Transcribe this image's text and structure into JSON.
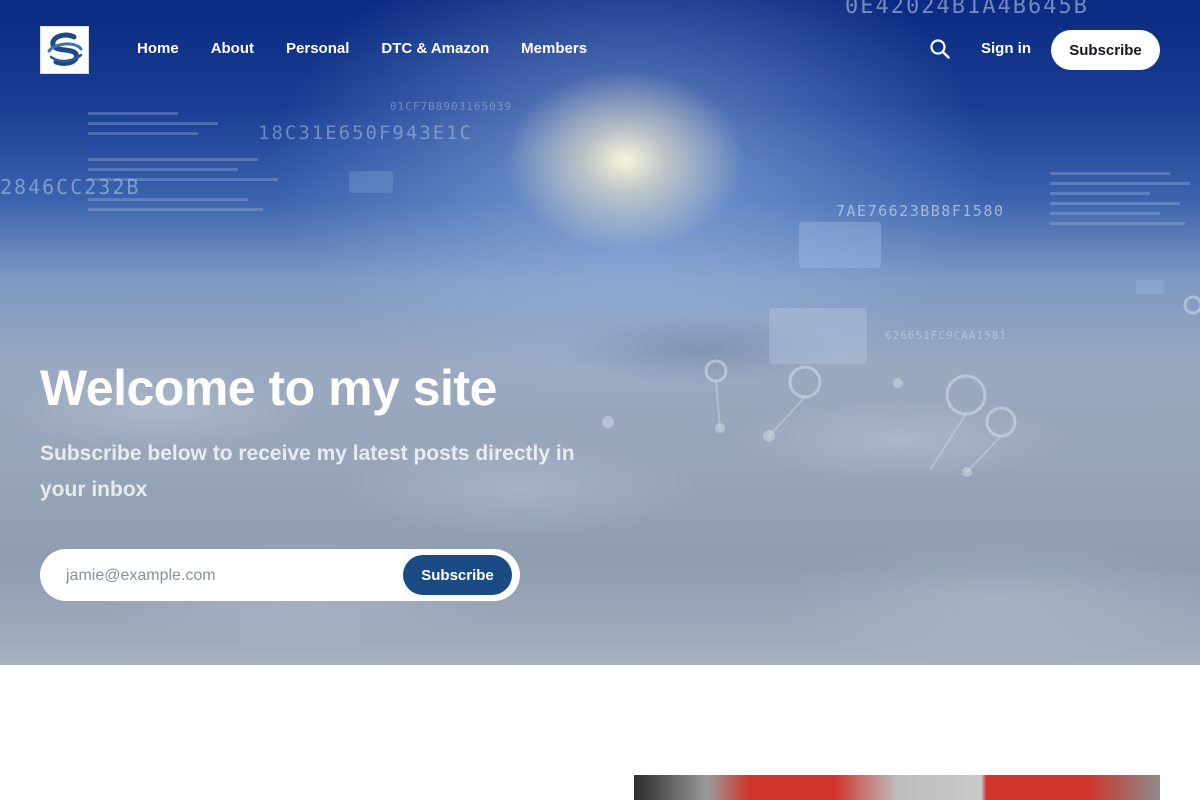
{
  "site": {
    "logo_alt": "Site logo",
    "brand_color": "#1b4b84"
  },
  "nav": {
    "items": [
      {
        "label": "Home"
      },
      {
        "label": "About"
      },
      {
        "label": "Personal"
      },
      {
        "label": "DTC & Amazon"
      },
      {
        "label": "Members"
      }
    ],
    "search_icon": "search-icon",
    "signin_label": "Sign in",
    "subscribe_label": "Subscribe"
  },
  "hero": {
    "title": "Welcome to my site",
    "description": "Subscribe below to receive my latest posts directly in your inbox",
    "form": {
      "email_placeholder": "jamie@example.com",
      "submit_label": "Subscribe"
    },
    "overlay_codes": [
      "0E42024B1A4B645B",
      "18C31E650F943E1C",
      "7AE76623BB8F1580",
      "2846CC232B",
      "01CF7B8903165039",
      "626651FC9CAA1581"
    ]
  },
  "colors": {
    "accent": "#1b4b84",
    "text_light": "#ffffff"
  }
}
